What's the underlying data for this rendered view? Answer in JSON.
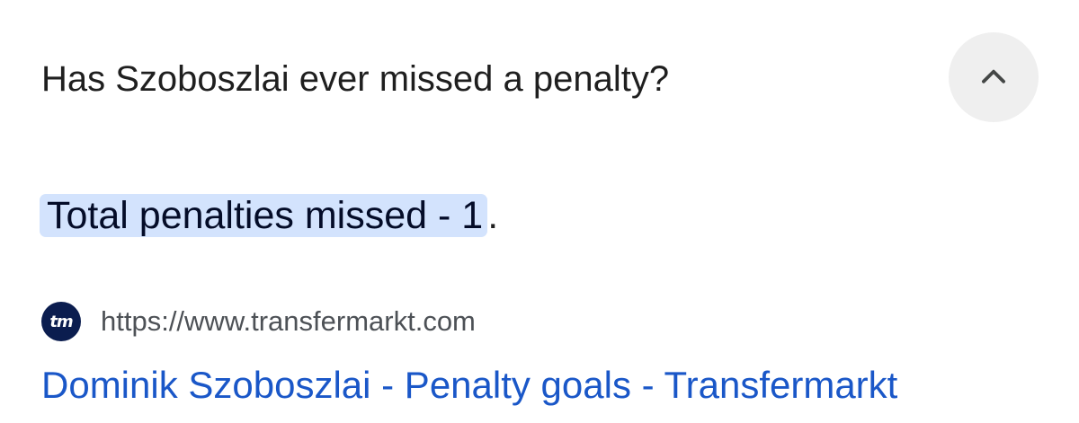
{
  "question": "Has Szoboszlai ever missed a penalty?",
  "collapse_icon": "chevron-up-icon",
  "answer": {
    "highlighted_text": "Total penalties missed - 1",
    "trailing_text": "."
  },
  "source": {
    "favicon_text": "tm",
    "url": "https://www.transfermarkt.com"
  },
  "result_title": "Dominik Szoboszlai - Penalty goals - Transfermarkt",
  "colors": {
    "highlight": "#d3e3fd",
    "link": "#1a57c8",
    "favicon_bg": "#0b1d4f",
    "button_bg": "#efefef"
  }
}
